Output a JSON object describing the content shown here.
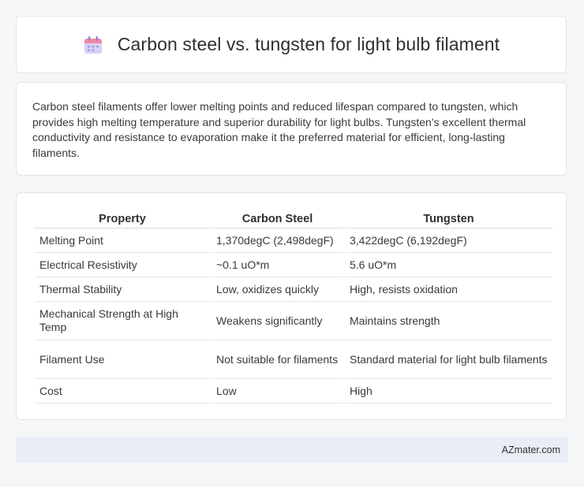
{
  "header": {
    "title": "Carbon steel vs. tungsten for light bulb filament",
    "icon": "calendar-icon"
  },
  "summary": "Carbon steel filaments offer lower melting points and reduced lifespan compared to tungsten, which provides high melting temperature and superior durability for light bulbs. Tungsten's excellent thermal conductivity and resistance to evaporation make it the preferred material for efficient, long-lasting filaments.",
  "table": {
    "headers": [
      "Property",
      "Carbon Steel",
      "Tungsten"
    ],
    "rows": [
      [
        "Melting Point",
        "1,370degC (2,498degF)",
        "3,422degC (6,192degF)"
      ],
      [
        "Electrical Resistivity",
        "~0.1 uO*m",
        "5.6 uO*m"
      ],
      [
        "Thermal Stability",
        "Low, oxidizes quickly",
        "High, resists oxidation"
      ],
      [
        "Mechanical Strength at High Temp",
        "Weakens significantly",
        "Maintains strength"
      ],
      [
        "Filament Use",
        "Not suitable for filaments",
        "Standard material for light bulb filaments"
      ],
      [
        "Cost",
        "Low",
        "High"
      ]
    ]
  },
  "footer": {
    "source": "AZmater.com"
  },
  "colors": {
    "background": "#f5f6f8",
    "card": "#ffffff",
    "footer": "#e9eef6",
    "icon_top": "#f08aa0",
    "icon_body": "#c9c3f0"
  }
}
